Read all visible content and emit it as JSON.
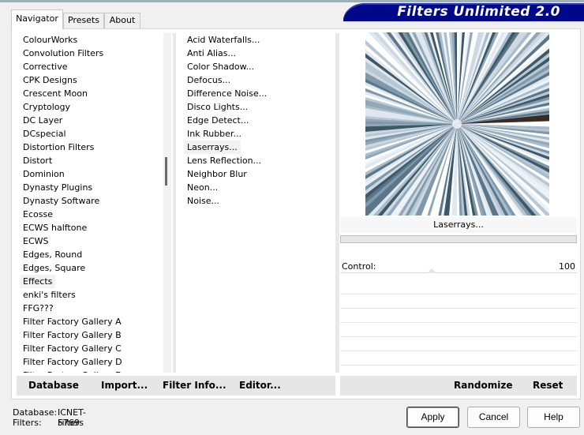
{
  "app": {
    "title": "Filters Unlimited 2.0"
  },
  "tabs": [
    {
      "label": "Navigator",
      "active": true
    },
    {
      "label": "Presets",
      "active": false
    },
    {
      "label": "About",
      "active": false
    }
  ],
  "categories": [
    "ColourWorks",
    "Convolution Filters",
    "Corrective",
    "CPK Designs",
    "Crescent Moon",
    "Cryptology",
    "DC Layer",
    "DCspecial",
    "Distortion Filters",
    "Distort",
    "Dominion",
    "Dynasty Plugins",
    "Dynasty Software",
    "Ecosse",
    "ECWS halftone",
    "ECWS",
    "Edges, Round",
    "Edges, Square",
    "Effects",
    "enki's filters",
    "FFG???",
    "Filter Factory Gallery A",
    "Filter Factory Gallery B",
    "Filter Factory Gallery C",
    "Filter Factory Gallery D",
    "Filter Factory Gallery E"
  ],
  "selected_category": "Effects",
  "filters": [
    "Acid Waterfalls...",
    "Anti Alias...",
    "Color Shadow...",
    "Defocus...",
    "Difference Noise...",
    "Disco Lights...",
    "Edge Detect...",
    "Ink Rubber...",
    "Laserrays...",
    "Lens Reflection...",
    "Neighbor Blur",
    "Neon...",
    "Noise..."
  ],
  "selected_filter": "Laserrays...",
  "preview": {
    "filter_name": "Laserrays..."
  },
  "control": {
    "label": "Control:",
    "value": "100"
  },
  "bottom_left_buttons": {
    "database": "Database",
    "import": "Import...",
    "filter_info": "Filter Info...",
    "editor": "Editor..."
  },
  "bottom_right_buttons": {
    "randomize": "Randomize",
    "reset": "Reset"
  },
  "db_info": {
    "database_label": "Database:",
    "database_value": "ICNET-Filters",
    "filters_label": "Filters:",
    "filters_value": "5769"
  },
  "dialog_buttons": {
    "apply": "Apply",
    "cancel": "Cancel",
    "help": "Help"
  },
  "colors": {
    "banner": "#00088a",
    "panel": "#ffffff",
    "background": "#f0f0f0"
  }
}
